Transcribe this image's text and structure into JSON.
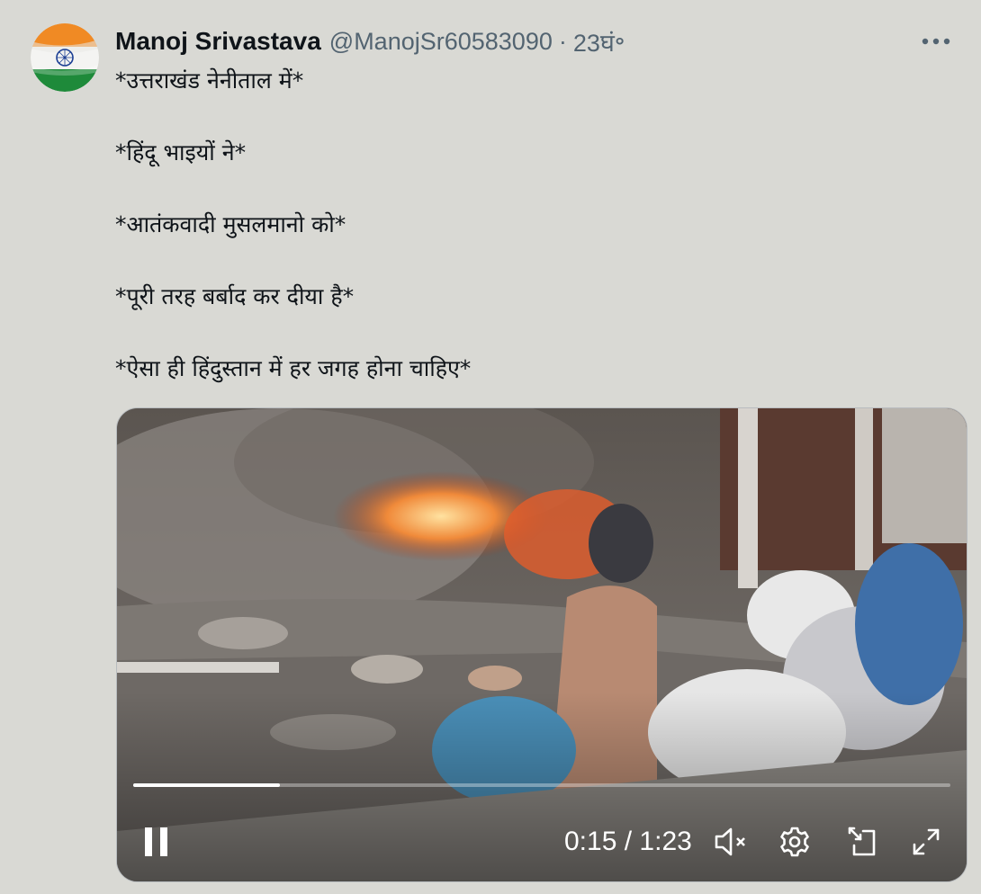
{
  "post": {
    "author": {
      "display_name": "Manoj Srivastava",
      "handle": "@ManojSr60583090",
      "separator": "·",
      "time_ago": "23घं॰",
      "avatar_icon": "india-flag-avatar"
    },
    "more_icon": "more-horizontal-icon",
    "text_lines": [
      "*उत्तराखंड नेनीताल में*",
      "*हिंदू भाइयों ने*",
      "*आतंकवादी मुसलमानो को*",
      "*पूरी तरह बर्बाद कर दीया है*",
      "*ऐसा ही हिंदुस्तान में हर जगह होना चाहिए*"
    ]
  },
  "video": {
    "state": "playing",
    "current_time": "0:15",
    "duration": "1:23",
    "time_separator": "/",
    "progress": 0.18,
    "controls": {
      "pause_icon": "pause-icon",
      "mute_icon": "volume-muted-icon",
      "settings_icon": "gear-icon",
      "pip_icon": "picture-in-picture-icon",
      "fullscreen_icon": "fullscreen-icon"
    }
  },
  "colors": {
    "background": "#d9d9d4",
    "text_primary": "#0f1419",
    "text_secondary": "#536471",
    "flag_saffron": "#f08a24",
    "flag_white": "#ffffff",
    "flag_green": "#1e8a3a",
    "chakra_blue": "#1c3f94"
  }
}
